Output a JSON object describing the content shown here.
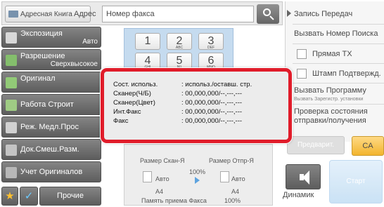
{
  "header": {
    "address_book_label": "Адресная Книга",
    "address_label": "Адрес",
    "fax_number_placeholder": "Номер факса"
  },
  "left_menu": {
    "items": [
      {
        "label": "Экспозиция",
        "value": "Авто"
      },
      {
        "label": "Разрешение",
        "value": "Сверхвысокое"
      },
      {
        "label": "Оригинал",
        "value": ""
      },
      {
        "label": "Работа Строит",
        "value": ""
      },
      {
        "label": "Реж. Медл.Прос",
        "value": ""
      },
      {
        "label": "Док.Смеш.Разм.",
        "value": ""
      },
      {
        "label": "Учет Оригиналов",
        "value": ""
      }
    ],
    "other_label": "Прочие"
  },
  "keypad": {
    "keys": [
      {
        "digit": "1",
        "letters": ""
      },
      {
        "digit": "2",
        "letters": "ABC"
      },
      {
        "digit": "3",
        "letters": "DEF"
      },
      {
        "digit": "4",
        "letters": "GHI"
      },
      {
        "digit": "5",
        "letters": "JKL"
      },
      {
        "digit": "6",
        "letters": "MNO"
      }
    ]
  },
  "size_panel": {
    "scan_size_label": "Размер Скан-Я",
    "send_size_label": "Размер Отпр-Я",
    "scan_value": "Авто",
    "send_value": "Авто",
    "ratio": "100%",
    "scan_paper": "A4",
    "send_paper": "A4",
    "memory_label": "Память приема Факса",
    "memory_value": "100%"
  },
  "right_panel": {
    "items": [
      {
        "label": "Запись Передач"
      },
      {
        "label": "Вызвать Номер Поиска"
      },
      {
        "label": "Прямая TX"
      },
      {
        "label": "Штамп Подтвержд."
      },
      {
        "label": "Вызвать Программу"
      },
      {
        "label": "Проверка состояния"
      },
      {
        "label": "отправки/получения"
      }
    ],
    "register_program_hint": "Вызвать Зарегистр. установки"
  },
  "actions": {
    "preview_label": "Предварит.",
    "ca_label": "CA",
    "speaker_label": "Динамик",
    "start_label": "Старт"
  },
  "popup": {
    "header_key": "Сост. использ.",
    "header_value": ": использ./оставш. стр.",
    "rows": [
      {
        "key": "Сканер(Ч/Б)",
        "value": ": 00,000,000/--,---,---"
      },
      {
        "key": "Сканер(Цвет)",
        "value": ": 00,000,000/--,---,---"
      },
      {
        "key": "Инт.Факс",
        "value": ": 00,000,000/--,---,---"
      },
      {
        "key": "Факс",
        "value": ": 00,000,000/--,---,---"
      }
    ],
    "border_color": "#e01c2a"
  }
}
